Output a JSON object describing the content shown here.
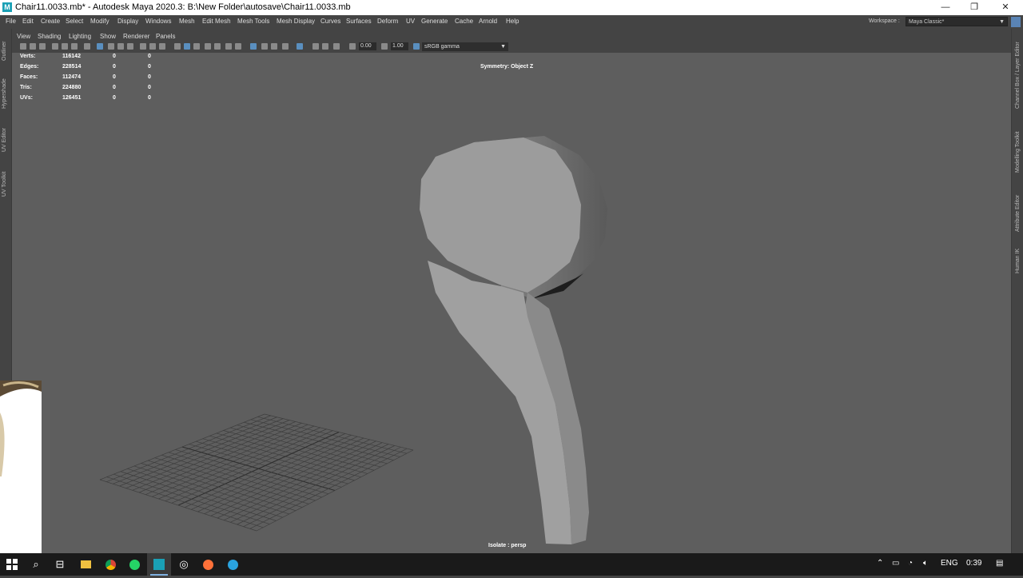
{
  "window": {
    "title": "Chair11.0033.mb* - Autodesk Maya 2020.3: B:\\New Folder\\autosave\\Chair11.0033.mb",
    "logo_letter": "M",
    "minimize": "—",
    "restore": "❐",
    "close": "✕"
  },
  "menubar": {
    "items": [
      "File",
      "Edit",
      "Create",
      "Select",
      "Modify",
      "Display",
      "Windows",
      "Mesh",
      "Edit Mesh",
      "Mesh Tools",
      "Mesh Display",
      "Curves",
      "Surfaces",
      "Deform",
      "UV",
      "Generate",
      "Cache",
      "Arnold",
      "Help"
    ],
    "workspace_label": "Workspace :",
    "workspace_value": "Maya Classic*"
  },
  "left_dock": {
    "tabs": [
      "Outliner",
      "Hypershade",
      "UV Editor",
      "UV Toolkit"
    ]
  },
  "right_dock": {
    "tabs": [
      "Channel Box / Layer Editor",
      "Modelling Toolkit",
      "Attribute Editor",
      "Human IK"
    ]
  },
  "panel_menu": {
    "items": [
      "View",
      "Shading",
      "Lighting",
      "Show",
      "Renderer",
      "Panels"
    ]
  },
  "toolbar": {
    "field_exposure": "0.00",
    "field_gamma": "1.00",
    "color_space": "sRGB gamma"
  },
  "hud": {
    "stats": [
      {
        "label": "Verts:",
        "value": "116142",
        "sel": "0",
        "comp": "0"
      },
      {
        "label": "Edges:",
        "value": "228514",
        "sel": "0",
        "comp": "0"
      },
      {
        "label": "Faces:",
        "value": "112474",
        "sel": "0",
        "comp": "0"
      },
      {
        "label": "Tris:",
        "value": "224880",
        "sel": "0",
        "comp": "0"
      },
      {
        "label": "UVs:",
        "value": "126451",
        "sel": "0",
        "comp": "0"
      }
    ],
    "symmetry": "Symmetry: Object Z",
    "isolate": "Isolate : persp"
  },
  "taskbar": {
    "language": "ENG",
    "time": "0:39"
  },
  "colors": {
    "viewport_bg": "#5e5e5e",
    "ui_bg": "#444444",
    "accent": "#5a8fbf",
    "taskbar": "#1a1a1a"
  }
}
